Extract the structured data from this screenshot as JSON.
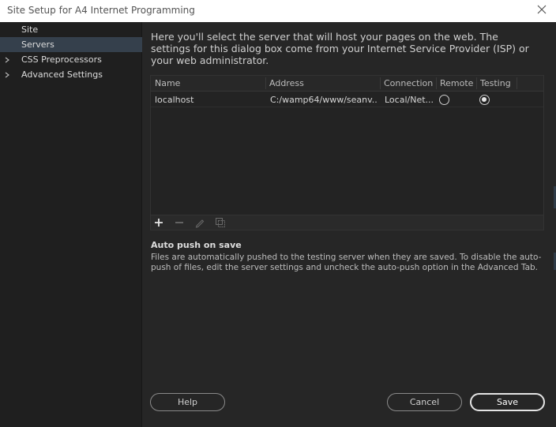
{
  "window": {
    "title": "Site Setup for A4 Internet Programming"
  },
  "sidebar": {
    "items": [
      {
        "label": "Site",
        "expandable": false,
        "active": false
      },
      {
        "label": "Servers",
        "expandable": false,
        "active": true
      },
      {
        "label": "CSS Preprocessors",
        "expandable": true,
        "active": false
      },
      {
        "label": "Advanced Settings",
        "expandable": true,
        "active": false
      }
    ]
  },
  "main": {
    "intro": "Here you'll select the server that will host your pages on the web. The settings for this dialog box come from your Internet Service Provider (ISP) or your web administrator.",
    "table": {
      "columns": [
        "Name",
        "Address",
        "Connection",
        "Remote",
        "Testing"
      ],
      "rows": [
        {
          "name": "localhost",
          "address": "C:/wamp64/www/seanv...",
          "connection": "Local/Net...",
          "remote": false,
          "testing": true
        }
      ]
    },
    "toolbar": [
      "add-icon",
      "remove-icon",
      "edit-icon",
      "duplicate-icon"
    ],
    "auto_push": {
      "title": "Auto push on save",
      "text": "Files are automatically pushed to the testing server when they are saved. To disable the auto-push of files, edit the server settings and uncheck the auto-push option in the Advanced Tab."
    }
  },
  "buttons": {
    "help": "Help",
    "cancel": "Cancel",
    "save": "Save"
  },
  "colors": {
    "background": "#262626",
    "sidebar_active": "#35404c",
    "primary_button_border": "#e4e4e4"
  }
}
